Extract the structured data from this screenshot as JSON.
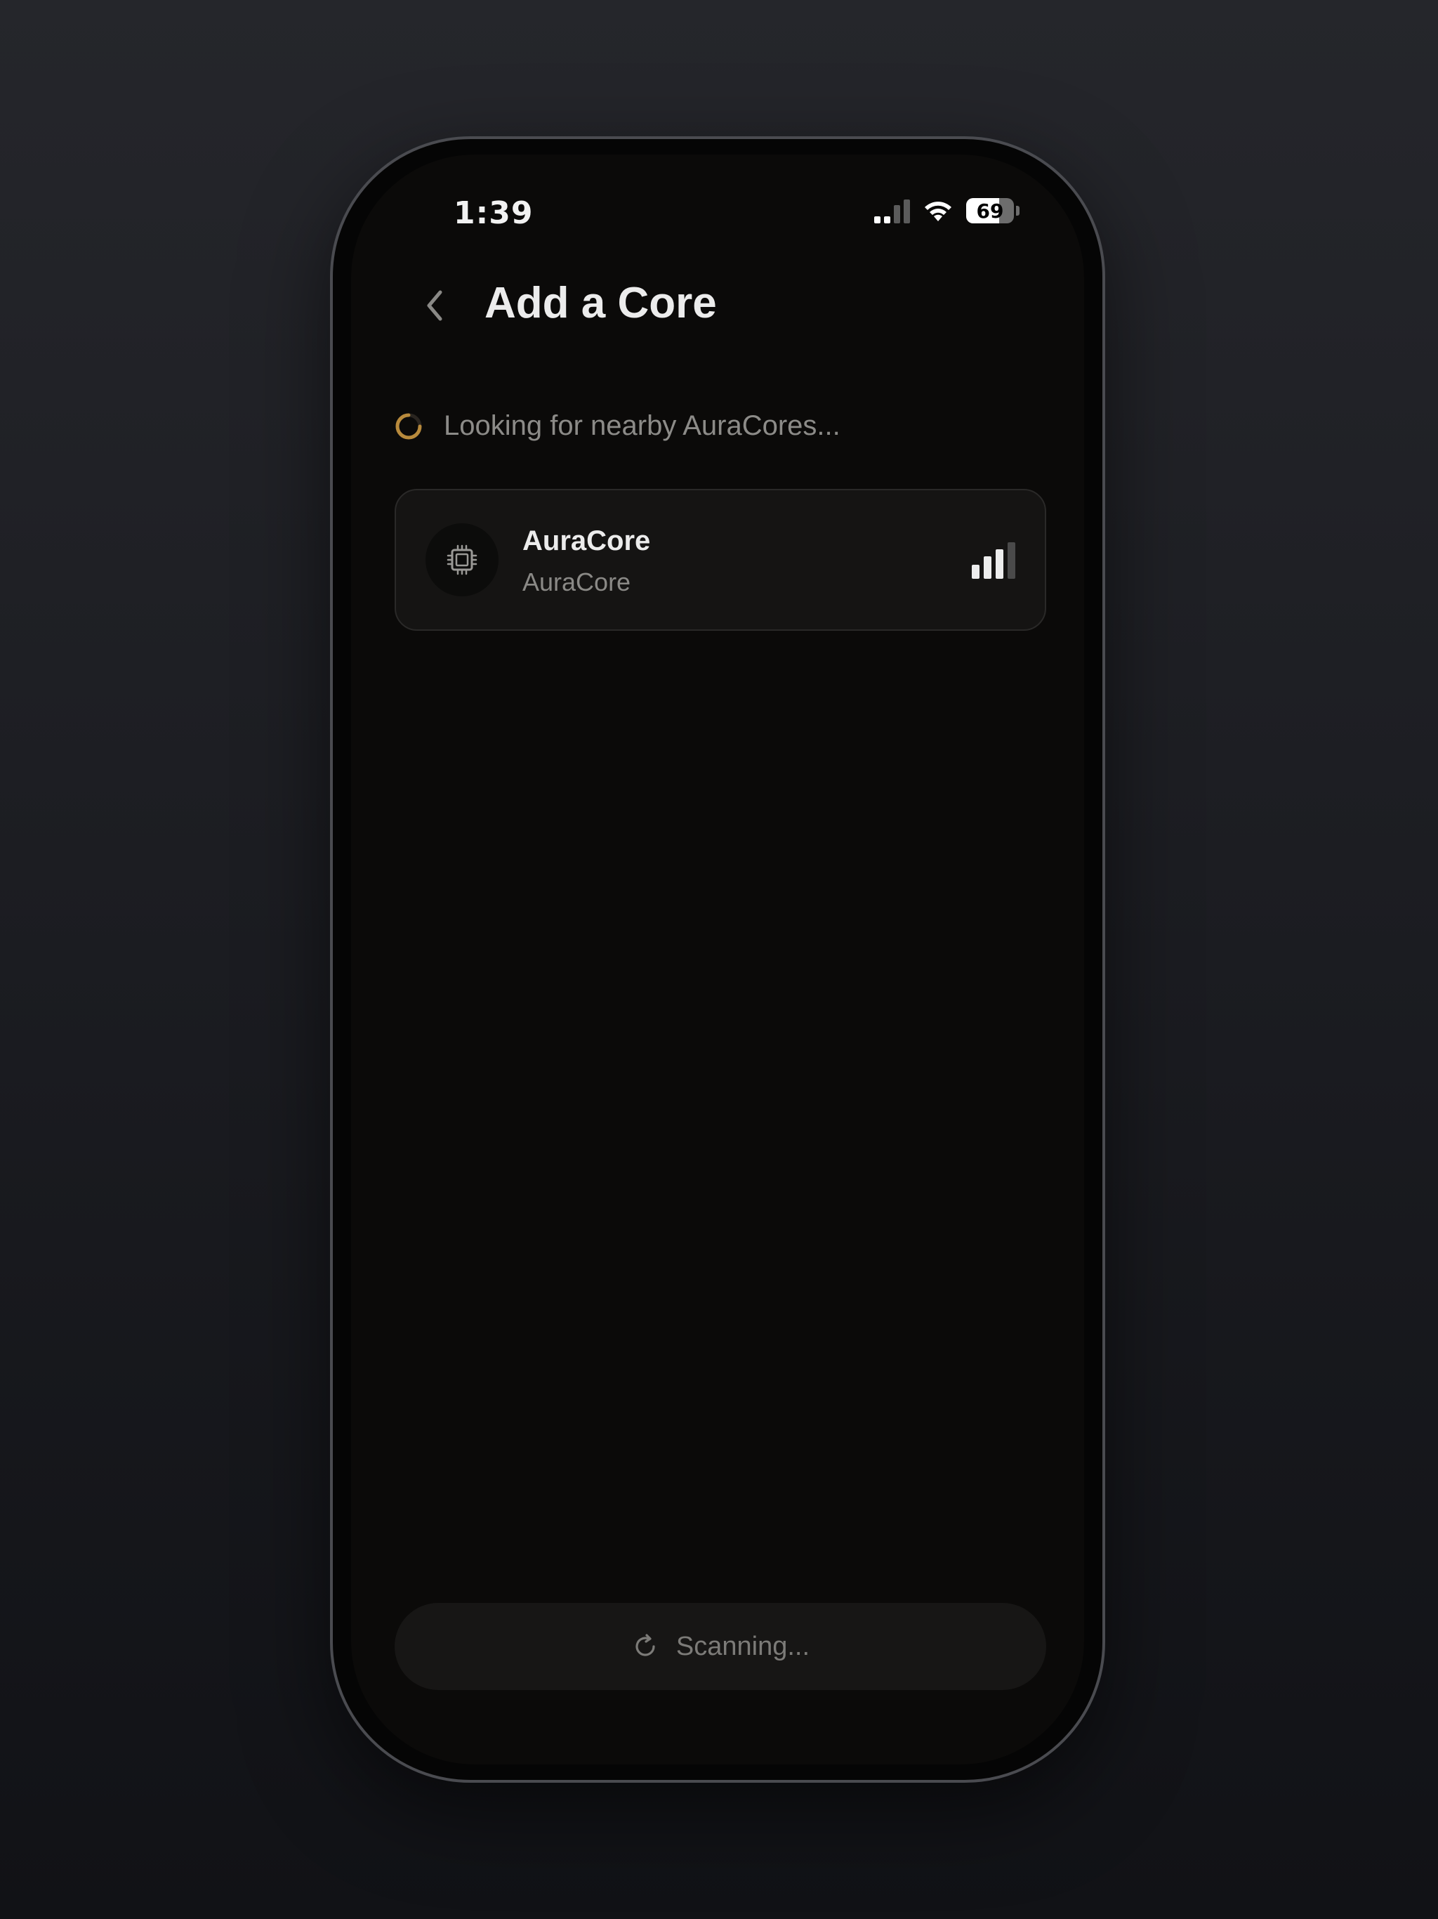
{
  "status_bar": {
    "time": "1:39",
    "battery_percent": "69",
    "battery_level": 0.69,
    "cellular_bars_active": 2,
    "cellular_bars_total": 4
  },
  "header": {
    "title": "Add a Core",
    "back_icon": "chevron-left-icon"
  },
  "scan_status": {
    "text": "Looking for nearby AuraCores...",
    "icon": "spinner-icon",
    "accent_color": "#b88a3c"
  },
  "devices": [
    {
      "name": "AuraCore",
      "subtitle": "AuraCore",
      "icon": "chip-icon",
      "signal_bars_active": 3,
      "signal_bars_total": 4
    }
  ],
  "footer": {
    "button_label": "Scanning...",
    "button_icon": "refresh-icon"
  },
  "colors": {
    "screen_background": "#0b0a09",
    "card_background": "#151413",
    "accent": "#b88a3c"
  }
}
